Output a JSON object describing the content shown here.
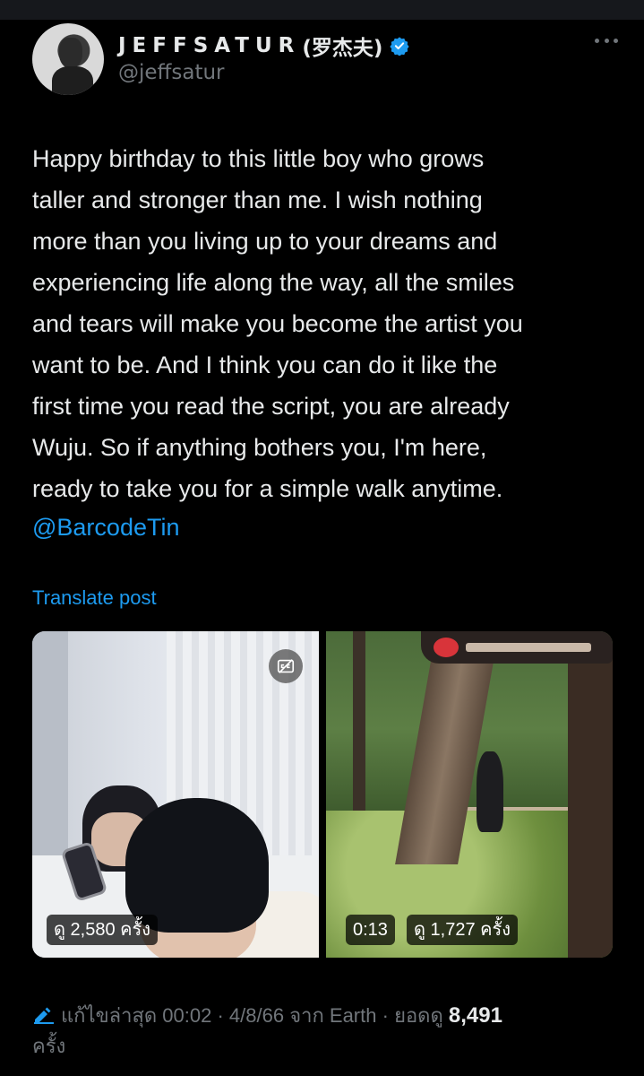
{
  "author": {
    "display_name": "JEFFSATUR",
    "display_name_suffix": "(罗杰夫)",
    "handle": "@jeffsatur"
  },
  "tweet": {
    "lines": [
      "Happy birthday to this little boy who grows",
      "taller and stronger than me. I wish nothing",
      "more than you living up to your dreams and",
      "experiencing life along the way, all the smiles",
      "and tears will make you become the artist you",
      "want to be. And I think you can do it like the",
      "first time you read the script, you are already",
      "Wuju. So if anything bothers you, I'm here,",
      "ready to take you for a simple walk anytime."
    ],
    "mention": "@BarcodeTin",
    "translate_label": "Translate post"
  },
  "media": [
    {
      "views": "ดู 2,580 ครั้ง"
    },
    {
      "duration": "0:13",
      "views": "ดู 1,727 ครั้ง"
    }
  ],
  "footer": {
    "edited": "แก้ไขล่าสุด",
    "time": "00:02",
    "date": "4/8/66",
    "location": "จาก Earth",
    "views_label": "ยอดดู",
    "views_count": "8,491",
    "views_unit": "ครั้ง"
  },
  "colors": {
    "background": "#000000",
    "accent": "#1d9bf0",
    "muted": "#71767b",
    "text": "#e7e9ea"
  },
  "icons": [
    "verified-badge-icon",
    "more-icon",
    "captions-icon",
    "edit-pencil-icon"
  ]
}
